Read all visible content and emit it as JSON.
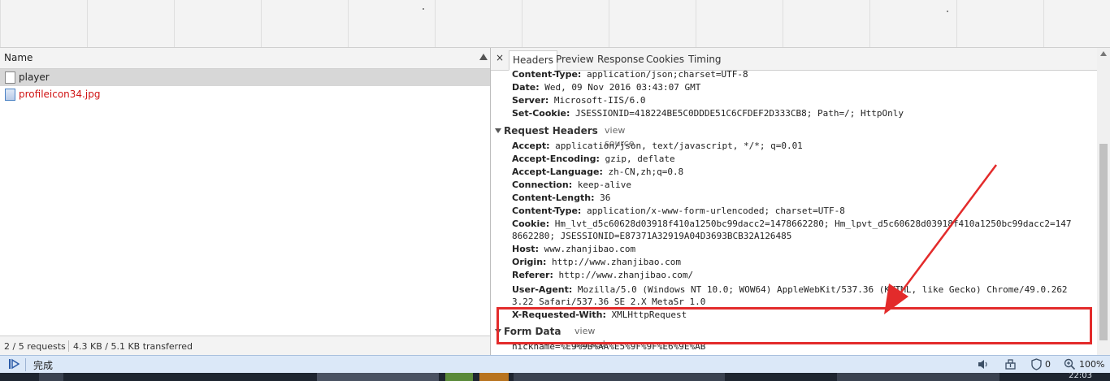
{
  "network": {
    "name_column": "Name",
    "requests": [
      {
        "name": "player",
        "error": false
      },
      {
        "name": "profileicon34.jpg",
        "error": true
      }
    ],
    "status": {
      "requests": "2 / 5 requests",
      "transferred": "4.3 KB / 5.1 KB transferred"
    }
  },
  "tabs": [
    "Headers",
    "Preview",
    "Response",
    "Cookies",
    "Timing"
  ],
  "close_glyph": "×",
  "response_headers": [
    {
      "key": "Content-Type:",
      "value": "application/json;charset=UTF-8"
    },
    {
      "key": "Date:",
      "value": "Wed, 09 Nov 2016 03:43:07 GMT"
    },
    {
      "key": "Server:",
      "value": "Microsoft-IIS/6.0"
    },
    {
      "key": "Set-Cookie:",
      "value": "JSESSIONID=418224BE5C0DDDE51C6CFDEF2D333CB8; Path=/; HttpOnly"
    }
  ],
  "request_headers_section": {
    "title": "Request Headers",
    "link": "view source"
  },
  "request_headers": [
    {
      "key": "Accept:",
      "value": "application/json, text/javascript, */*; q=0.01"
    },
    {
      "key": "Accept-Encoding:",
      "value": "gzip, deflate"
    },
    {
      "key": "Accept-Language:",
      "value": "zh-CN,zh;q=0.8"
    },
    {
      "key": "Connection:",
      "value": "keep-alive"
    },
    {
      "key": "Content-Length:",
      "value": "36"
    },
    {
      "key": "Content-Type:",
      "value": "application/x-www-form-urlencoded; charset=UTF-8"
    },
    {
      "key": "Cookie:",
      "value": "Hm_lvt_d5c60628d03918f410a1250bc99dacc2=1478662280; Hm_lpvt_d5c60628d03918f410a1250bc99dacc2=147",
      "cont": "8662280; JSESSIONID=E87371A32919A04D3693BCB32A126485"
    },
    {
      "key": "Host:",
      "value": "www.zhanjibao.com"
    },
    {
      "key": "Origin:",
      "value": "http://www.zhanjibao.com"
    },
    {
      "key": "Referer:",
      "value": "http://www.zhanjibao.com/"
    },
    {
      "key": "User-Agent:",
      "value": "Mozilla/5.0 (Windows NT 10.0; WOW64) AppleWebKit/537.36 (KHTML, like Gecko) Chrome/49.0.262",
      "cont": "3.22 Safari/537.36 SE 2.X MetaSr 1.0"
    },
    {
      "key": "X-Requested-With:",
      "value": "XMLHttpRequest"
    }
  ],
  "form_data_section": {
    "title": "Form Data",
    "link": "view parsed"
  },
  "form_data": "nickname=%E9%9B%AA%E5%9F%9F%E6%9E%AB",
  "browser_status": {
    "done": "完成",
    "counter": "0",
    "zoom": "100%"
  },
  "taskbar": {
    "clock": "22:03"
  }
}
